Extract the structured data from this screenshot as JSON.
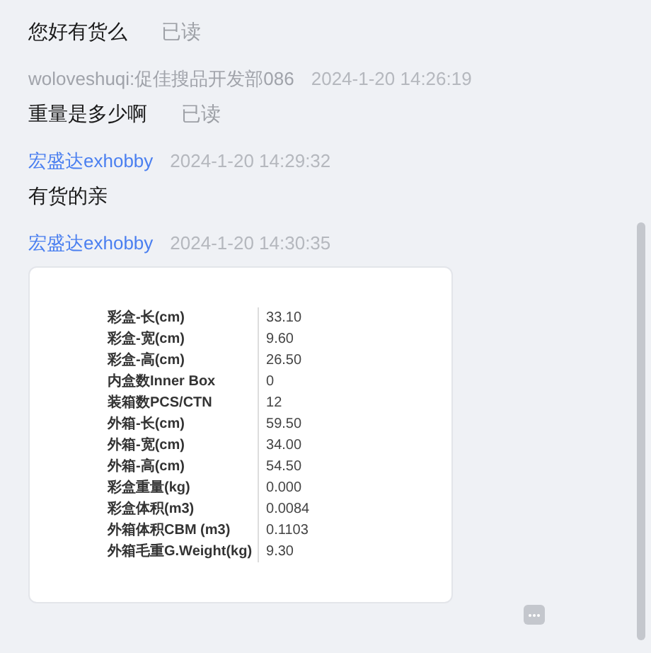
{
  "messages": [
    {
      "text": "您好有货么",
      "read_label": "已读"
    },
    {
      "sender": "woloveshuqi:促佳搜品开发部086",
      "time": "2024-1-20 14:26:19",
      "kind": "customer",
      "text": "重量是多少啊",
      "read_label": "已读"
    },
    {
      "sender": "宏盛达exhobby",
      "time": "2024-1-20 14:29:32",
      "kind": "seller",
      "text": "有货的亲"
    },
    {
      "sender": "宏盛达exhobby",
      "time": "2024-1-20 14:30:35",
      "kind": "seller",
      "spec_table": [
        {
          "label": "彩盒-长(cm)",
          "value": "33.10"
        },
        {
          "label": "彩盒-宽(cm)",
          "value": "9.60"
        },
        {
          "label": "彩盒-高(cm)",
          "value": "26.50"
        },
        {
          "label": "内盒数Inner Box",
          "value": "0"
        },
        {
          "label": "装箱数PCS/CTN",
          "value": "12"
        },
        {
          "label": "外箱-长(cm)",
          "value": "59.50"
        },
        {
          "label": "外箱-宽(cm)",
          "value": "34.00"
        },
        {
          "label": "外箱-高(cm)",
          "value": "54.50"
        },
        {
          "label": "彩盒重量(kg)",
          "value": "0.000"
        },
        {
          "label": "彩盒体积(m3)",
          "value": "0.0084"
        },
        {
          "label": "外箱体积CBM (m3)",
          "value": "0.1103"
        },
        {
          "label": "外箱毛重G.Weight(kg)",
          "value": "9.30"
        }
      ]
    }
  ]
}
